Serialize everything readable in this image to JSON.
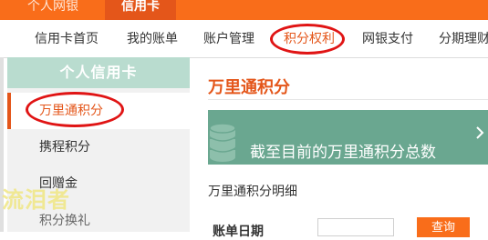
{
  "top_tabs": [
    "个人网银",
    "信用卡"
  ],
  "subnav": [
    "信用卡首页",
    "我的账单",
    "账户管理",
    "积分权利",
    "网银支付",
    "分期理财"
  ],
  "sidebar": {
    "header": "个人信用卡",
    "items": [
      "万里通积分",
      "携程积分",
      "回赠金",
      "积分换礼"
    ]
  },
  "main": {
    "title": "万里通积分",
    "banner_text": "截至目前的万里通积分总数",
    "details_label": "万里通积分明细",
    "filter_label": "账单日期",
    "search_button": "查询"
  },
  "watermark": "流泪者",
  "colors": {
    "brand_orange": "#f96d1a",
    "accent_orange": "#e4561a",
    "sidebar_header": "#b9dccf",
    "banner": "#6aa790",
    "annotation_circle": "#e01414"
  }
}
